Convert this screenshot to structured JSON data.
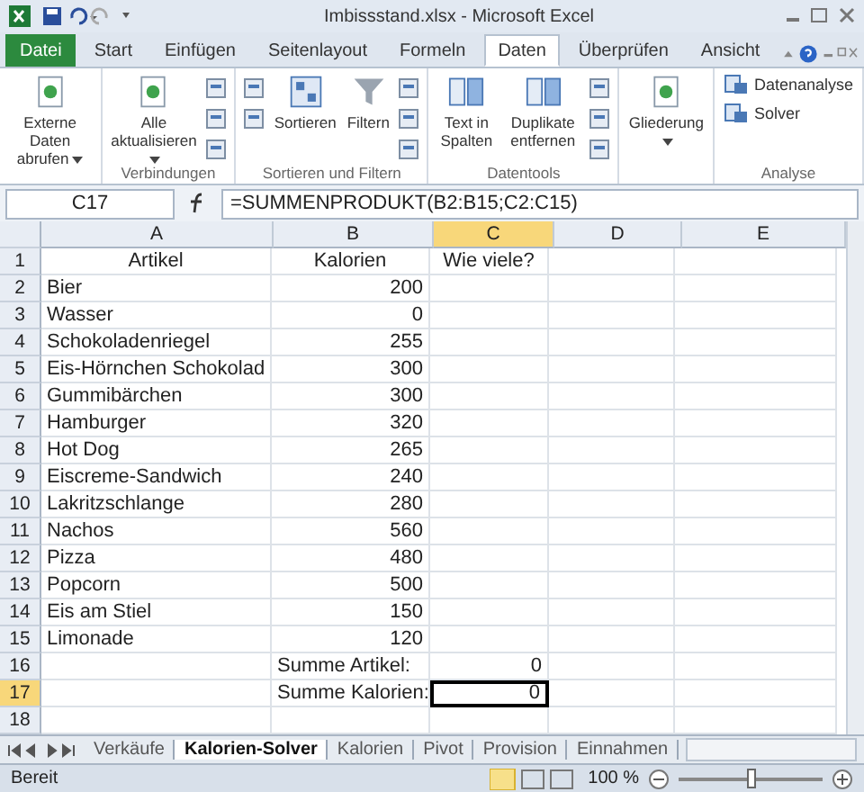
{
  "window": {
    "title": "Imbissstand.xlsx - Microsoft Excel"
  },
  "tabs": [
    {
      "label": "Datei",
      "kind": "file",
      "selected": false
    },
    {
      "label": "Start",
      "kind": "tab",
      "selected": false
    },
    {
      "label": "Einfügen",
      "kind": "tab",
      "selected": false
    },
    {
      "label": "Seitenlayout",
      "kind": "tab",
      "selected": false
    },
    {
      "label": "Formeln",
      "kind": "tab",
      "selected": false
    },
    {
      "label": "Daten",
      "kind": "tab",
      "selected": true
    },
    {
      "label": "Überprüfen",
      "kind": "tab",
      "selected": false
    },
    {
      "label": "Ansicht",
      "kind": "tab",
      "selected": false
    }
  ],
  "ribbon": {
    "groups": [
      {
        "items": [
          {
            "kind": "big",
            "label": "Externe Daten abrufen",
            "menu": true
          }
        ]
      },
      {
        "label": "Verbindungen",
        "items": [
          {
            "kind": "big",
            "label": "Alle aktualisieren",
            "menu": true
          },
          {
            "kind": "smalls"
          }
        ]
      },
      {
        "label": "Sortieren und Filtern",
        "items": [
          {
            "kind": "smalls"
          },
          {
            "kind": "big",
            "label": "Sortieren",
            "menu": false
          },
          {
            "kind": "big",
            "label": "Filtern",
            "menu": false
          },
          {
            "kind": "smalls"
          }
        ]
      },
      {
        "label": "Datentools",
        "items": [
          {
            "kind": "big",
            "label": "Text in Spalten",
            "menu": false
          },
          {
            "kind": "big",
            "label": "Duplikate entfernen",
            "menu": false
          },
          {
            "kind": "smalls"
          }
        ]
      },
      {
        "items": [
          {
            "kind": "big",
            "label": "Gliederung",
            "menu": true
          }
        ]
      },
      {
        "label": "Analyse",
        "items": [
          {
            "kind": "rows",
            "labels": [
              "Datenanalyse",
              "Solver"
            ]
          }
        ]
      }
    ]
  },
  "formula_bar": {
    "name_box": "C17",
    "formula": "=SUMMENPRODUKT(B2:B15;C2:C15)"
  },
  "columns": [
    {
      "label": "A",
      "selected": false
    },
    {
      "label": "B",
      "selected": false
    },
    {
      "label": "C",
      "selected": true
    },
    {
      "label": "D",
      "selected": false
    },
    {
      "label": "E",
      "selected": false
    }
  ],
  "rows": [
    {
      "number": "1",
      "kind": "heading",
      "selected": false,
      "cells": [
        "Artikel",
        "Kalorien",
        "Wie viele?"
      ]
    },
    {
      "number": "2",
      "kind": "item",
      "selected": false,
      "cells": [
        "Bier",
        "200"
      ]
    },
    {
      "number": "3",
      "kind": "item",
      "selected": false,
      "cells": [
        "Wasser",
        "0"
      ]
    },
    {
      "number": "4",
      "kind": "item",
      "selected": false,
      "cells": [
        "Schokoladenriegel",
        "255"
      ]
    },
    {
      "number": "5",
      "kind": "item",
      "selected": false,
      "cells": [
        "Eis-Hörnchen Schokolad",
        "300"
      ]
    },
    {
      "number": "6",
      "kind": "item",
      "selected": false,
      "cells": [
        "Gummibärchen",
        "300"
      ]
    },
    {
      "number": "7",
      "kind": "item",
      "selected": false,
      "cells": [
        "Hamburger",
        "320"
      ]
    },
    {
      "number": "8",
      "kind": "item",
      "selected": false,
      "cells": [
        "Hot Dog",
        "265"
      ]
    },
    {
      "number": "9",
      "kind": "item",
      "selected": false,
      "cells": [
        "Eiscreme-Sandwich",
        "240"
      ]
    },
    {
      "number": "10",
      "kind": "item",
      "selected": false,
      "cells": [
        "Lakritzschlange",
        "280"
      ]
    },
    {
      "number": "11",
      "kind": "item",
      "selected": false,
      "cells": [
        "Nachos",
        "560"
      ]
    },
    {
      "number": "12",
      "kind": "item",
      "selected": false,
      "cells": [
        "Pizza",
        "480"
      ]
    },
    {
      "number": "13",
      "kind": "item",
      "selected": false,
      "cells": [
        "Popcorn",
        "500"
      ]
    },
    {
      "number": "14",
      "kind": "item",
      "selected": false,
      "cells": [
        "Eis am Stiel",
        "150"
      ]
    },
    {
      "number": "15",
      "kind": "item",
      "selected": false,
      "cells": [
        "Limonade",
        "120"
      ]
    },
    {
      "number": "16",
      "kind": "total",
      "selected": false,
      "cells": [
        "",
        "Summe Artikel:",
        "0"
      ]
    },
    {
      "number": "17",
      "kind": "total",
      "selected": true,
      "cells": [
        "",
        "Summe Kalorien:",
        "0"
      ]
    },
    {
      "number": "18",
      "kind": "item",
      "selected": false,
      "cells": []
    }
  ],
  "sheet_tabs": [
    {
      "label": "Verkäufe",
      "selected": false
    },
    {
      "label": "Kalorien-Solver",
      "selected": true
    },
    {
      "label": "Kalorien",
      "selected": false
    },
    {
      "label": "Pivot",
      "selected": false
    },
    {
      "label": "Provision",
      "selected": false
    },
    {
      "label": "Einnahmen",
      "selected": false
    }
  ],
  "status_bar": {
    "status": "Bereit",
    "zoom": "100 %",
    "level": 0.5
  }
}
